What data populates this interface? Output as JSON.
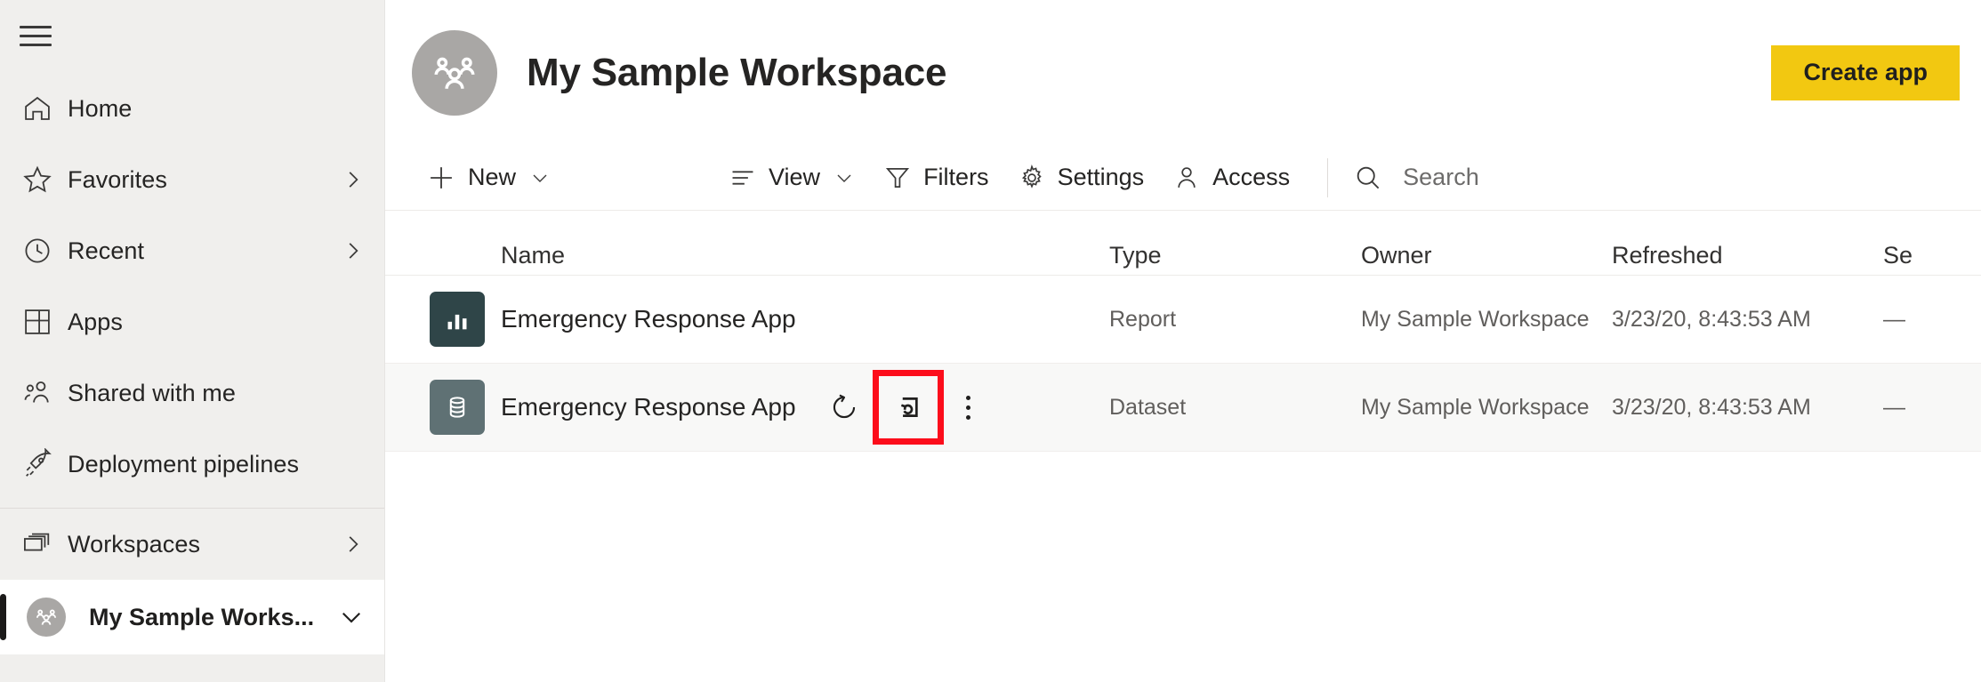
{
  "colors": {
    "sidebar_bg": "#f0efed",
    "accent_yellow": "#f2c811",
    "report_icon_bg": "#2f4548",
    "dataset_icon_bg": "#5f7174",
    "highlight_red": "#fc0d1b",
    "row_hover_bg": "#f8f8f7",
    "avatar_bg": "#a9a7a5",
    "text_primary": "#252423",
    "text_secondary": "#605e5c"
  },
  "sidebar": {
    "menu_toggle_name": "hamburger-icon",
    "items": [
      {
        "label": "Home",
        "icon": "home-icon",
        "chevron": false,
        "active": false
      },
      {
        "label": "Favorites",
        "icon": "star-icon",
        "chevron": true,
        "active": false
      },
      {
        "label": "Recent",
        "icon": "clock-icon",
        "chevron": true,
        "active": false
      },
      {
        "label": "Apps",
        "icon": "apps-grid-icon",
        "chevron": false,
        "active": false
      },
      {
        "label": "Shared with me",
        "icon": "people-icon",
        "chevron": false,
        "active": false
      },
      {
        "label": "Deployment pipelines",
        "icon": "rocket-icon",
        "chevron": false,
        "active": false
      },
      {
        "label": "Workspaces",
        "icon": "workspaces-stack-icon",
        "chevron": true,
        "active": false
      }
    ],
    "active_workspace": {
      "label": "My Sample Works...",
      "avatar_icon": "workspace-group-avatar",
      "chevron_icon": "chevron-down-icon"
    }
  },
  "header": {
    "avatar_icon": "workspace-group-avatar",
    "title": "My Sample Workspace",
    "create_app_label": "Create app"
  },
  "toolbar": {
    "new_label": "New",
    "new_icon": "plus-icon",
    "view_label": "View",
    "view_icon": "list-view-icon",
    "filters_label": "Filters",
    "filters_icon": "funnel-icon",
    "settings_label": "Settings",
    "settings_icon": "gear-icon",
    "access_label": "Access",
    "access_icon": "person-icon",
    "search_icon": "search-icon",
    "search_placeholder": "Search",
    "search_value": ""
  },
  "table": {
    "columns": [
      "Name",
      "Type",
      "Owner",
      "Refreshed",
      "Se"
    ],
    "rows": [
      {
        "icon": "report-bar-chart-icon",
        "icon_kind": "report",
        "name": "Emergency Response App",
        "type": "Report",
        "owner": "My Sample Workspace",
        "refreshed": "3/23/20, 8:43:53 AM",
        "sensitivity": "—",
        "hovered": false,
        "actions": []
      },
      {
        "icon": "dataset-database-icon",
        "icon_kind": "dataset",
        "name": "Emergency Response App",
        "type": "Dataset",
        "owner": "My Sample Workspace",
        "refreshed": "3/23/20, 8:43:53 AM",
        "sensitivity": "—",
        "hovered": true,
        "actions": [
          {
            "name": "refresh-now-icon",
            "label": "Refresh now",
            "highlighted": false
          },
          {
            "name": "schedule-refresh-icon",
            "label": "Schedule refresh",
            "highlighted": true
          },
          {
            "name": "more-options-icon",
            "label": "More options",
            "highlighted": false
          }
        ]
      }
    ]
  }
}
